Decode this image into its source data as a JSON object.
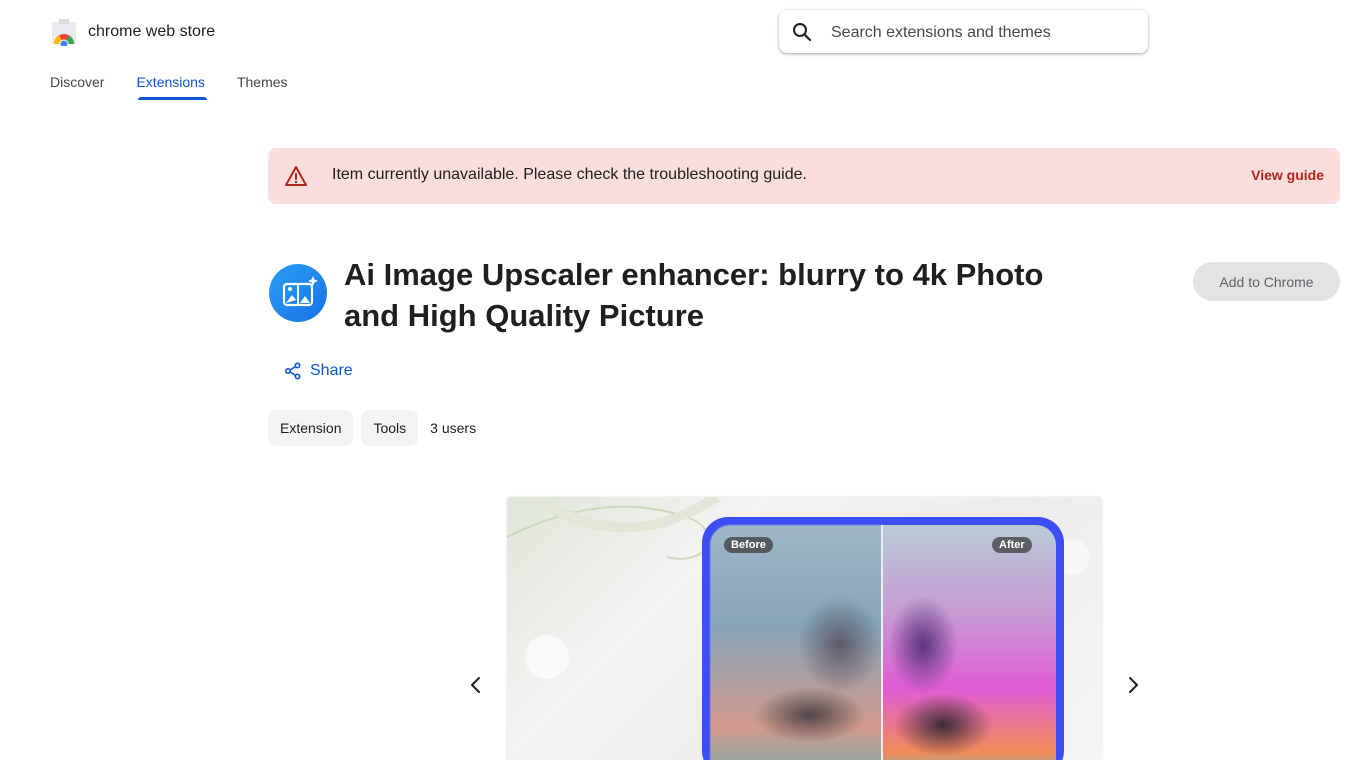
{
  "header": {
    "logo_text": "chrome web store",
    "search_placeholder": "Search extensions and themes"
  },
  "nav": {
    "items": [
      {
        "label": "Discover",
        "active": false
      },
      {
        "label": "Extensions",
        "active": true
      },
      {
        "label": "Themes",
        "active": false
      }
    ]
  },
  "banner": {
    "message": "Item currently unavailable. Please check the troubleshooting guide.",
    "link_label": "View guide",
    "background_color": "#f9dedc",
    "link_color": "#b3261e"
  },
  "extension": {
    "title": "Ai Image Upscaler enhancer: blurry to 4k Photo and High Quality Picture",
    "add_button_label": "Add to Chrome",
    "share_label": "Share",
    "chips": [
      "Extension",
      "Tools"
    ],
    "users": "3 users"
  },
  "carousel": {
    "before_label": "Before",
    "after_label": "After"
  },
  "colors": {
    "accent": "#0b57d0",
    "frame": "#3d4ef5"
  }
}
